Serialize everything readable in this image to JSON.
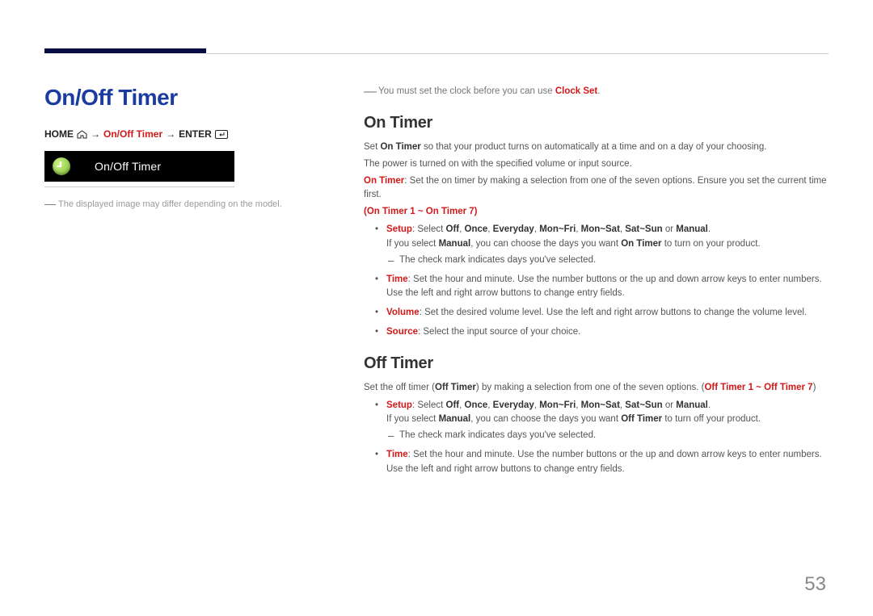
{
  "page_number": "53",
  "left": {
    "title": "On/Off Timer",
    "breadcrumb": {
      "home": "HOME",
      "arrow": "→",
      "item": "On/Off Timer",
      "enter": "ENTER"
    },
    "menu_label": "On/Off Timer",
    "note": "The displayed image may differ depending on the model."
  },
  "right": {
    "pre_note_a": "You must set the clock before you can use ",
    "pre_note_b": "Clock Set",
    "pre_note_c": ".",
    "on_timer": {
      "heading": "On Timer",
      "p1_a": "Set ",
      "p1_b": "On Timer",
      "p1_c": " so that your product turns on automatically at a time and on a day of your choosing.",
      "p2": "The power is turned on with the specified volume or input source.",
      "p3_a": "On Timer",
      "p3_b": ": Set the on timer by making a selection from one of the seven options. Ensure you set the current time first.",
      "range": "(On Timer 1 ~ On Timer 7)",
      "setup": {
        "label": "Setup",
        "tail1": ": Select ",
        "opt_off": "Off",
        "opt_once": "Once",
        "opt_everyday": "Everyday",
        "opt_monfri": "Mon~Fri",
        "opt_monsat": "Mon~Sat",
        "opt_satsun": "Sat~Sun",
        "or": " or ",
        "opt_manual": "Manual",
        "tail2": ".",
        "line2_a": "If you select ",
        "line2_b": "Manual",
        "line2_c": ", you can choose the days you want ",
        "line2_d": "On Timer",
        "line2_e": " to turn on your product.",
        "sub": "The check mark indicates days you've selected."
      },
      "time": {
        "label": "Time",
        "body": ": Set the hour and minute. Use the number buttons or the up and down arrow keys to enter numbers. Use the left and right arrow buttons to change entry fields."
      },
      "volume": {
        "label": "Volume",
        "body": ": Set the desired volume level. Use the left and right arrow buttons to change the volume level."
      },
      "source": {
        "label": "Source",
        "body": ": Select the input source of your choice."
      }
    },
    "off_timer": {
      "heading": "Off Timer",
      "p1_a": "Set the off timer (",
      "p1_b": "Off Timer",
      "p1_c": ") by making a selection from one of the seven options. (",
      "p1_d": "Off Timer 1 ~ Off Timer 7",
      "p1_e": ")",
      "setup": {
        "label": "Setup",
        "tail1": ": Select ",
        "opt_off": "Off",
        "opt_once": "Once",
        "opt_everyday": "Everyday",
        "opt_monfri": "Mon~Fri",
        "opt_monsat": "Mon~Sat",
        "opt_satsun": "Sat~Sun",
        "or": " or ",
        "opt_manual": "Manual",
        "tail2": ".",
        "line2_a": "If you select ",
        "line2_b": "Manual",
        "line2_c": ", you can choose the days you want ",
        "line2_d": "Off Timer",
        "line2_e": " to turn off your product.",
        "sub": "The check mark indicates days you've selected."
      },
      "time": {
        "label": "Time",
        "body": ": Set the hour and minute. Use the number buttons or the up and down arrow keys to enter numbers. Use the left and right arrow buttons to change entry fields."
      }
    }
  }
}
